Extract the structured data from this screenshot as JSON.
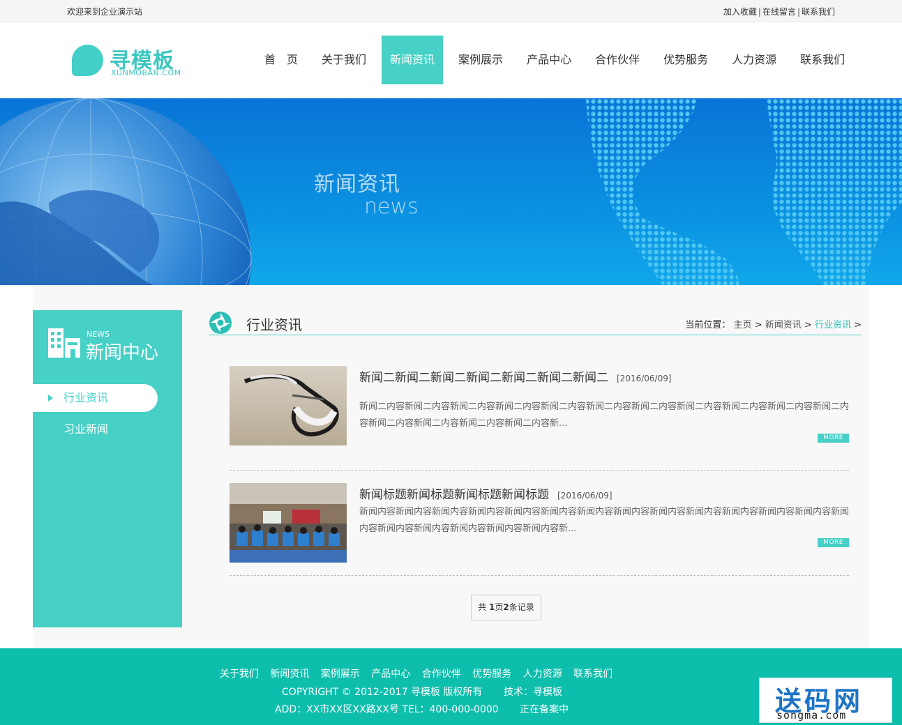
{
  "topbar": {
    "welcome": "欢迎来到企业演示站",
    "links": [
      "加入收藏",
      "在线留言",
      "联系我们"
    ]
  },
  "logo": {
    "cn": "寻模板",
    "en": "XUNMOBAN.COM"
  },
  "nav": {
    "items": [
      "首　页",
      "关于我们",
      "新闻资讯",
      "案例展示",
      "产品中心",
      "合作伙伴",
      "优势服务",
      "人力资源",
      "联系我们"
    ],
    "active": "新闻资讯"
  },
  "banner": {
    "cn": "新闻资讯",
    "en": "news"
  },
  "sidebar": {
    "en": "NEWS",
    "title": "新闻中心",
    "items": [
      "行业资讯",
      "习业新闻"
    ]
  },
  "content": {
    "title": "行业资讯",
    "breadcrumb": {
      "prefix": "当前位置：",
      "items": [
        "主页",
        "新闻资讯",
        "行业资讯"
      ],
      "sep": ">"
    }
  },
  "news": [
    {
      "title": "新闻二新闻二新闻二新闻二新闻二新闻二新闻二",
      "date": "[2016/06/09]",
      "desc": "新闻二内容新闻二内容新闻二内容新闻二内容新闻二内容新闻二内容新闻二内容新闻二内容新闻二内容新闻二内容新闻二内容新闻二内容新闻二内容新闻二内容新闻二内容新...",
      "more": "MORE"
    },
    {
      "title": "新闻标题新闻标题新闻标题新闻标题",
      "date": "[2016/06/09]",
      "desc": "新闻内容新闻内容新闻内容新闻内容新闻内容新闻内容新闻内容新闻内容新闻内容新闻内容新闻内容新闻内容新闻内容新闻内容新闻内容新闻内容新闻内容新闻内容新闻内容新...",
      "more": "MORE"
    }
  ],
  "pager": {
    "pre": "共 ",
    "pages": "1",
    "mid": "页",
    "count": "2",
    "post": "条记录"
  },
  "footer": {
    "nav": [
      "关于我们",
      "新闻资讯",
      "案例展示",
      "产品中心",
      "合作伙伴",
      "优势服务",
      "人力资源",
      "联系我们"
    ],
    "copyright": "COPYRIGHT © 2012-2017 寻模板 版权所有",
    "tech": "技术：寻模板",
    "address": "ADD：XX市XX区XX路XX号  TEL：400-000-0000",
    "icp": "正在备案中"
  },
  "watermark": {
    "cn": "送码网",
    "en": "songma.com"
  },
  "colors": {
    "accent": "#46d0c6",
    "footer": "#0dbeac",
    "banner": "#0a8ee0"
  }
}
